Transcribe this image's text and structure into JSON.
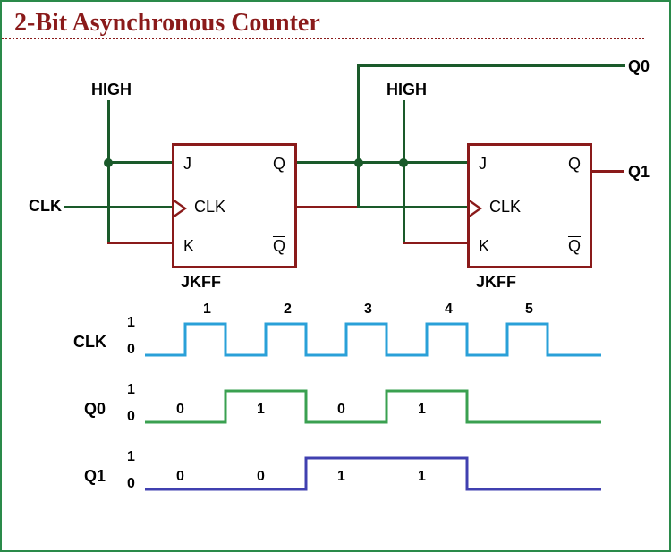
{
  "title": "2-Bit Asynchronous Counter",
  "labels": {
    "high1": "HIGH",
    "high2": "HIGH",
    "clk_in": "CLK",
    "q0_out": "Q0",
    "q1_out": "Q1"
  },
  "flipflop": {
    "pins": {
      "j": "J",
      "k": "K",
      "clk": "CLK",
      "q": "Q",
      "qbar": "Q"
    },
    "name1": "JKFF",
    "name2": "JKFF"
  },
  "timing": {
    "clk": {
      "label": "CLK",
      "hi": "1",
      "lo": "0",
      "numbers": [
        "1",
        "2",
        "3",
        "4",
        "5"
      ]
    },
    "q0": {
      "label": "Q0",
      "hi": "1",
      "lo": "0",
      "states": [
        "0",
        "1",
        "0",
        "1"
      ]
    },
    "q1": {
      "label": "Q1",
      "hi": "1",
      "lo": "0",
      "states": [
        "0",
        "0",
        "1",
        "1"
      ]
    }
  },
  "chart_data": {
    "type": "timing-diagram",
    "title": "2-Bit Asynchronous Counter timing",
    "signals": [
      {
        "name": "CLK",
        "pattern": [
          0,
          1,
          0,
          1,
          0,
          1,
          0,
          1,
          0,
          1,
          0
        ],
        "pulse_labels": [
          1,
          2,
          3,
          4,
          5
        ]
      },
      {
        "name": "Q0",
        "pattern_over_clk_periods": [
          0,
          1,
          0,
          1
        ],
        "labels": [
          "0",
          "1",
          "0",
          "1"
        ]
      },
      {
        "name": "Q1",
        "pattern_over_clk_periods": [
          0,
          0,
          1,
          1
        ],
        "labels": [
          "0",
          "0",
          "1",
          "1"
        ]
      }
    ]
  }
}
